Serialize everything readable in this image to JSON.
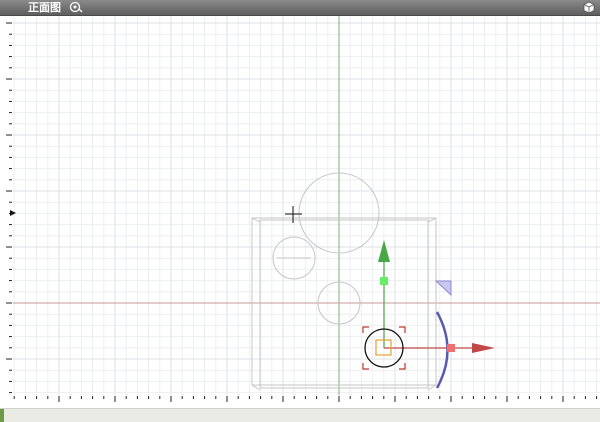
{
  "view": {
    "title": "正面图",
    "options_icon": "view-options-icon",
    "viewcube_icon": "viewcube-icon"
  },
  "colors": {
    "grid_minor": "#eceef0",
    "grid_major": "#dde1e5",
    "axis_vertical": "#7fae7f",
    "axis_horizontal": "#c79a9a",
    "sketch_line": "#c6c6c6",
    "gizmo_y": "#48a848",
    "gizmo_x": "#c24848",
    "gizmo_handle_y": "#66ee66",
    "gizmo_handle_x": "#f07070",
    "rotation_arc": "#5a5ab4",
    "corner_handle": "#c0392b",
    "center_square": "#e3a034"
  },
  "statusbar": {
    "text": ""
  }
}
